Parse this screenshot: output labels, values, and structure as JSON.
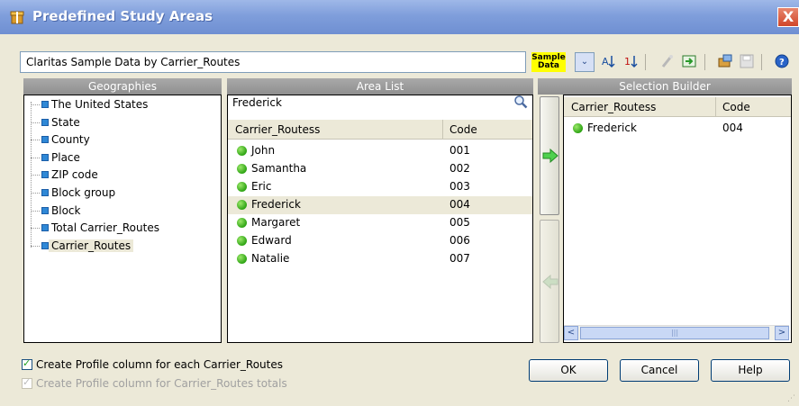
{
  "window": {
    "title": "Predefined Study Areas",
    "close_label": "X"
  },
  "toolbar": {
    "data_source": "Claritas Sample Data by Carrier_Routes",
    "sample_badge_line1": "Sample",
    "sample_badge_line2": "Data",
    "dropdown_glyph": "⌄",
    "icons": [
      "sort-az-icon",
      "sort-12-icon",
      "wand-icon",
      "export-icon",
      "database-icon",
      "save-icon",
      "help-icon"
    ]
  },
  "geographies": {
    "header": "Geographies",
    "items": [
      {
        "label": "The United States"
      },
      {
        "label": "State"
      },
      {
        "label": "County"
      },
      {
        "label": "Place"
      },
      {
        "label": "ZIP code"
      },
      {
        "label": "Block group"
      },
      {
        "label": "Block"
      },
      {
        "label": "Total Carrier_Routes"
      },
      {
        "label": "Carrier_Routes",
        "selected": true
      }
    ]
  },
  "area_list": {
    "header": "Area List",
    "search_value": "Frederick",
    "columns": {
      "name": "Carrier_Routess",
      "code": "Code"
    },
    "rows": [
      {
        "name": "John",
        "code": "001"
      },
      {
        "name": "Samantha",
        "code": "002"
      },
      {
        "name": "Eric",
        "code": "003"
      },
      {
        "name": "Frederick",
        "code": "004",
        "selected": true
      },
      {
        "name": "Margaret",
        "code": "005"
      },
      {
        "name": "Edward",
        "code": "006"
      },
      {
        "name": "Natalie",
        "code": "007"
      }
    ]
  },
  "selection_builder": {
    "header": "Selection Builder",
    "columns": {
      "name": "Carrier_Routess",
      "code": "Code"
    },
    "rows": [
      {
        "name": "Frederick",
        "code": "004"
      }
    ],
    "scroll_left": "<",
    "scroll_right": ">",
    "scroll_grip": "|||"
  },
  "options": {
    "profile_each": "Create Profile column for each Carrier_Routes",
    "profile_totals": "Create Profile column for Carrier_Routes totals"
  },
  "buttons": {
    "ok": "OK",
    "cancel": "Cancel",
    "help": "Help"
  },
  "colors": {
    "accent": "#6f8fd2",
    "selected_row": "#ece9d8",
    "status_dot": "#2ea414"
  }
}
